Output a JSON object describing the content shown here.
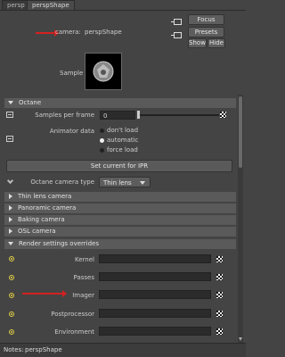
{
  "tabs": [
    {
      "label": "persp"
    },
    {
      "label": "perspShape"
    }
  ],
  "header": {
    "camera_label": "camera:",
    "camera_value": "perspShape",
    "focus_label": "Focus",
    "presets_label": "Presets",
    "show_label": "Show",
    "hide_label": "Hide"
  },
  "sample": {
    "label": "Sample"
  },
  "octane": {
    "section_label": "Octane",
    "samples_per_frame_label": "Samples per frame",
    "samples_per_frame_value": "0",
    "animator_data_label": "Animator data",
    "animator_options": [
      "don't load",
      "automatic",
      "force load"
    ],
    "animator_selected": "automatic",
    "set_current_label": "Set current for IPR",
    "camera_type_label": "Octane camera type",
    "camera_type_value": "Thin lens"
  },
  "collapsed_sections": [
    {
      "label": "Thin lens camera"
    },
    {
      "label": "Panoramic camera"
    },
    {
      "label": "Baking camera"
    },
    {
      "label": "OSL camera"
    }
  ],
  "render_overrides": {
    "section_label": "Render settings overrides",
    "rows": [
      {
        "label": "Kernel"
      },
      {
        "label": "Passes"
      },
      {
        "label": "Imager"
      },
      {
        "label": "Postprocessor"
      },
      {
        "label": "Environment"
      }
    ]
  },
  "notes": {
    "label": "Notes:",
    "value": "perspShape"
  },
  "colors": {
    "background": "#444444",
    "section": "#5a5a5a",
    "field": "#2b2b2b",
    "arrow": "#d42020",
    "connector": "#e0cf45"
  }
}
